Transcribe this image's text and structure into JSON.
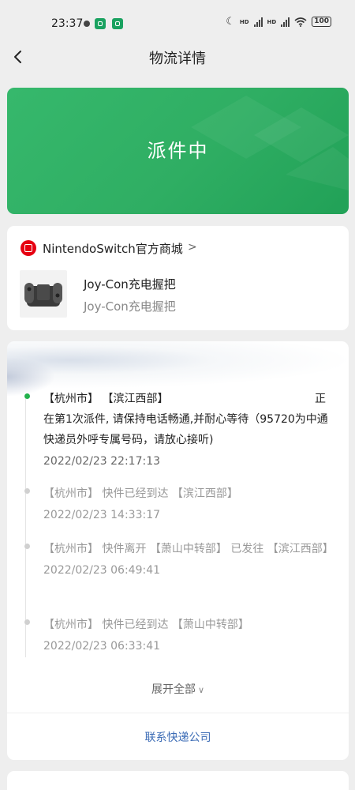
{
  "status_bar": {
    "time": "23:37",
    "battery": "100",
    "network_labels": [
      "HD",
      "HD"
    ]
  },
  "header": {
    "title": "物流详情"
  },
  "banner": {
    "status": "派件中",
    "color": "#2fae63"
  },
  "store": {
    "name": "NintendoSwitch官方商城",
    "product_name": "Joy-Con充电握把",
    "product_spec": "Joy-Con充电握把"
  },
  "tracking": {
    "events": [
      {
        "text": "【杭州市】 【滨江西部】",
        "text_tail": "正",
        "text_cont": "在第1次派件, 请保持电话畅通,并耐心等待（95720为中通快递员外呼专属号码，请放心接听)",
        "time": "2022/02/23 22:17:13"
      },
      {
        "text": "【杭州市】 快件已经到达 【滨江西部】",
        "time": "2022/02/23 14:33:17"
      },
      {
        "text": "【杭州市】 快件离开 【萧山中转部】 已发往 【滨江西部】",
        "time": "2022/02/23 06:49:41"
      },
      {
        "text": "【杭州市】 快件已经到达 【萧山中转部】",
        "time": "2022/02/23 06:33:41"
      }
    ],
    "expand_label": "展开全部",
    "contact_label": "联系快递公司"
  },
  "colors": {
    "accent_green": "#22b14c",
    "link_blue": "#3b6bb5"
  }
}
